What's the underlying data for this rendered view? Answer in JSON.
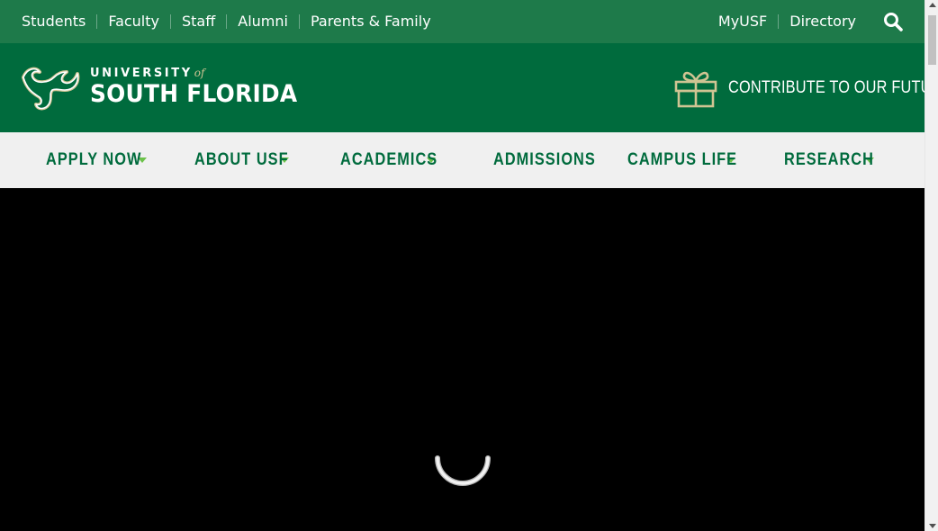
{
  "utility_nav": {
    "left_links": [
      "Students",
      "Faculty",
      "Staff",
      "Alumni",
      "Parents & Family"
    ],
    "right_links": [
      "MyUSF",
      "Directory"
    ],
    "search_icon": "search-icon"
  },
  "brand": {
    "university_label": "UNIVERSITY",
    "of_label": "of",
    "name": "SOUTH FLORIDA",
    "logo_icon": "bull-horns-logo-icon",
    "contribute_label": "CONTRIBUTE TO OUR FUTURE",
    "gift_icon": "gift-icon"
  },
  "main_nav": {
    "items": [
      {
        "label": "APPLY NOW",
        "has_dropdown": true
      },
      {
        "label": "ABOUT USF",
        "has_dropdown": true
      },
      {
        "label": "ACADEMICS",
        "has_dropdown": true
      },
      {
        "label": "ADMISSIONS",
        "has_dropdown": false
      },
      {
        "label": "CAMPUS LIFE",
        "has_dropdown": true
      },
      {
        "label": "RESEARCH",
        "has_dropdown": true
      }
    ]
  },
  "hero": {
    "state": "loading",
    "spinner_icon": "loading-spinner-icon"
  },
  "colors": {
    "utility_bar": "#1e7a4a",
    "brand_bar": "#006b3d",
    "nav_bg": "#f0f0f0",
    "nav_text": "#006b3d",
    "caret": "#6cc24a",
    "gold": "#cfc493",
    "hero_bg": "#000000"
  }
}
